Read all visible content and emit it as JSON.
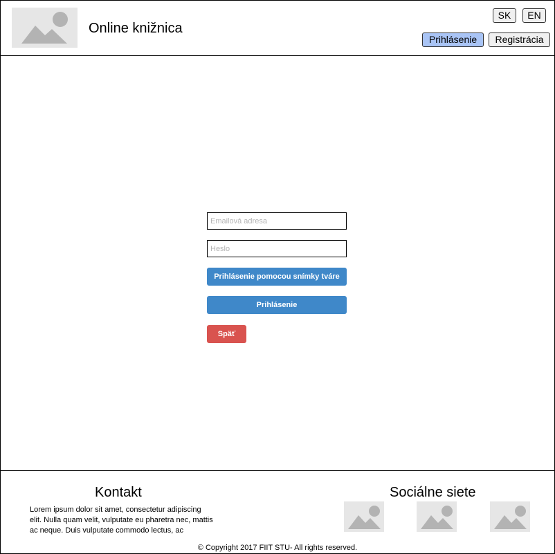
{
  "header": {
    "logo_icon": "image-placeholder-icon",
    "title": "Online knižnica",
    "languages": {
      "sk": "SK",
      "en": "EN"
    },
    "nav": {
      "login": "Prihlásenie",
      "register": "Registrácia"
    },
    "colors": {
      "active_nav": "#a9c4f5",
      "nav_default": "#f0f0f0"
    }
  },
  "login_form": {
    "email_placeholder": "Emailová adresa",
    "email_value": "",
    "password_placeholder": "Heslo",
    "password_value": "",
    "face_login_button": "Prihlásenie pomocou snímky tváre",
    "login_button": "Prihlásenie",
    "back_button": "Späť",
    "colors": {
      "primary": "#3f88c9",
      "danger": "#d9534f"
    }
  },
  "footer": {
    "contact_heading": "Kontakt",
    "contact_text": "Lorem ipsum dolor sit amet, consectetur adipiscing elit. Nulla quam velit, vulputate eu pharetra nec, mattis ac neque. Duis vulputate commodo lectus, ac",
    "social_heading": "Sociálne siete",
    "social_icons": [
      "image-placeholder-icon",
      "image-placeholder-icon",
      "image-placeholder-icon"
    ],
    "copyright": "© Copyright 2017 FIIT STU- All rights reserved."
  }
}
